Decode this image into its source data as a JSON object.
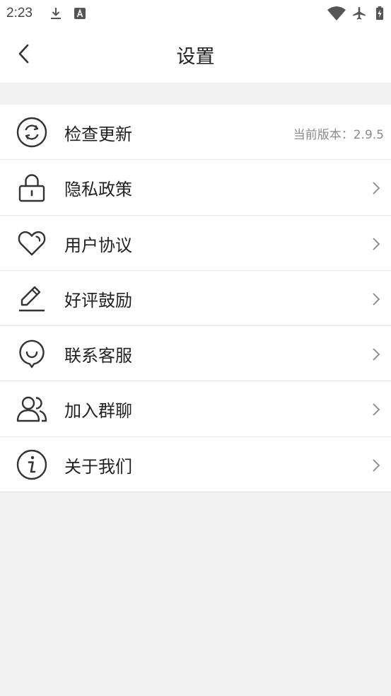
{
  "status_bar": {
    "time": "2:23",
    "icons": [
      "download-icon",
      "a-box-icon",
      "wifi-icon",
      "airplane-icon",
      "battery-charging-icon"
    ]
  },
  "header": {
    "title": "设置",
    "back_icon": "chevron-left-icon"
  },
  "settings": {
    "items": [
      {
        "label": "检查更新",
        "icon": "refresh-icon",
        "value": "当前版本：2.9.5"
      },
      {
        "label": "隐私政策",
        "icon": "lock-icon"
      },
      {
        "label": "用户协议",
        "icon": "heart-icon"
      },
      {
        "label": "好评鼓励",
        "icon": "pencil-icon"
      },
      {
        "label": "联系客服",
        "icon": "chat-smile-icon"
      },
      {
        "label": "加入群聊",
        "icon": "users-icon"
      },
      {
        "label": "关于我们",
        "icon": "info-icon"
      }
    ]
  },
  "colors": {
    "background": "#f2f2f2",
    "surface": "#ffffff",
    "text": "#222222",
    "secondary_text": "#8a8a8a",
    "divider": "#e6e6e6"
  }
}
